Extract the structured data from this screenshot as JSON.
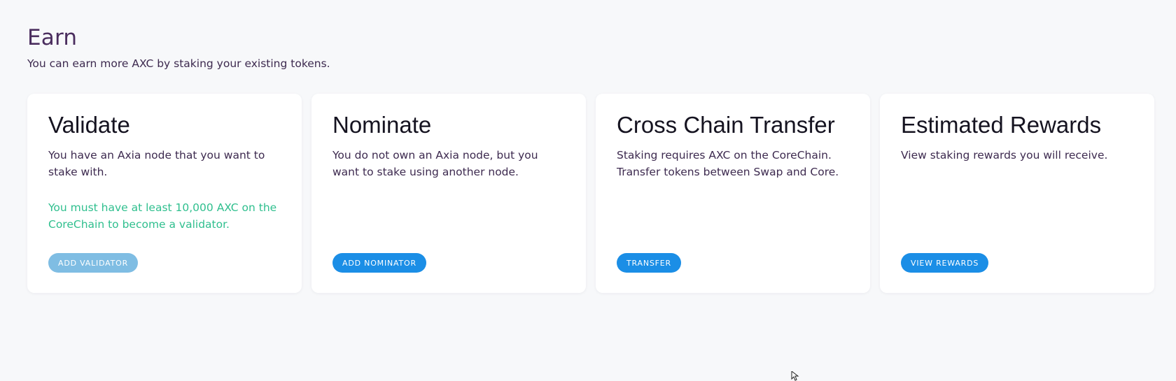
{
  "header": {
    "title": "Earn",
    "subtitle": "You can earn more AXC by staking your existing tokens."
  },
  "cards": [
    {
      "title": "Validate",
      "description": "You have an Axia node that you want to stake with.",
      "note": "You must have at least 10,000 AXC on the CoreChain to become a validator.",
      "button_label": "ADD VALIDATOR",
      "button_disabled": true
    },
    {
      "title": "Nominate",
      "description": "You do not own an Axia node, but you want to stake using another node.",
      "button_label": "ADD NOMINATOR",
      "button_disabled": false
    },
    {
      "title": "Cross Chain Transfer",
      "description": "Staking requires AXC on the CoreChain. Transfer tokens between Swap and Core.",
      "button_label": "TRANSFER",
      "button_disabled": false
    },
    {
      "title": "Estimated Rewards",
      "description": "View staking rewards you will receive.",
      "button_label": "VIEW REWARDS",
      "button_disabled": false
    }
  ],
  "colors": {
    "background": "#f7f8fa",
    "card": "#ffffff",
    "primary_button": "#1b8ee6",
    "disabled_button": "#7fbde3",
    "note_text": "#2fbf8e",
    "heading_text": "#151320",
    "body_text": "#3d2a4f"
  },
  "icons": {
    "cursor": "mouse-pointer-icon"
  }
}
